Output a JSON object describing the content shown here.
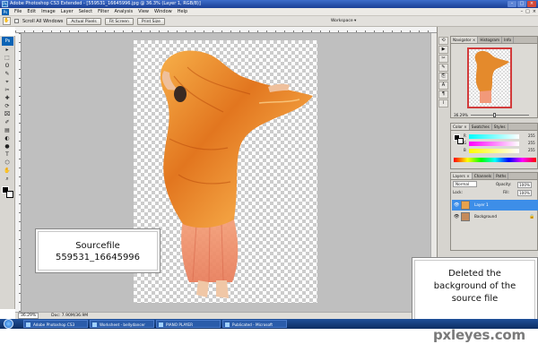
{
  "window": {
    "title": "Adobe Photoshop CS3 Extended - [559531_16645996.jpg @ 36.3% (Layer 1, RGB/8)]",
    "min": "–",
    "max": "□",
    "close": "×",
    "app_icon": "Ps"
  },
  "menu": {
    "items": [
      "File",
      "Edit",
      "Image",
      "Layer",
      "Select",
      "Filter",
      "Analysis",
      "View",
      "Window",
      "Help"
    ],
    "doc_controls": [
      "–",
      "□",
      "×"
    ]
  },
  "options": {
    "tool_icon": "hand-icon",
    "scroll_all_label": "Scroll All Windows",
    "buttons": [
      "Actual Pixels",
      "Fit Screen",
      "Print Size"
    ],
    "workspace_label": "Workspace ▾"
  },
  "toolbox": {
    "logo": "Ps",
    "tools": [
      "▸",
      "⬚",
      "ʘ",
      "✎",
      "⌖",
      "✂",
      "✚",
      "⟳",
      "⌧",
      "✐",
      "▤",
      "◐",
      "●",
      "T",
      "⬡",
      "✋",
      "⌕"
    ]
  },
  "status": {
    "zoom": "36.29%",
    "doc_info": "Doc: 7.90M/36.9M"
  },
  "navigator": {
    "tabs": [
      "Navigator ×",
      "Histogram",
      "Info"
    ],
    "zoom": "36.29%"
  },
  "color_panel": {
    "tabs": [
      "Color ×",
      "Swatches",
      "Styles"
    ],
    "channels": [
      {
        "label": "R",
        "value": "255",
        "color": "#e0407a"
      },
      {
        "label": "G",
        "value": "255",
        "color": "#40d040"
      },
      {
        "label": "B",
        "value": "255",
        "color": "#4a6ae0"
      }
    ]
  },
  "layers_panel": {
    "tabs": [
      "Layers ×",
      "Channels",
      "Paths"
    ],
    "blend_mode": "Normal",
    "opacity_label": "Opacity:",
    "opacity_value": "100%",
    "lock_label": "Lock:",
    "fill_label": "Fill:",
    "fill_value": "100%",
    "layers": [
      {
        "name": "Layer 1",
        "selected": true
      },
      {
        "name": "Background",
        "selected": false
      }
    ]
  },
  "notes": {
    "source": {
      "line1": "Sourcefile",
      "line2": "559531_16645996"
    },
    "deleted": {
      "line1": "Deleted the",
      "line2": "background of the",
      "line3": "source file"
    }
  },
  "taskbar": {
    "items": [
      "Adobe Photoshop CS3",
      "Worksheet - bellydancer",
      "PIANO PLAYER",
      "Publicated - Microsoft"
    ]
  },
  "watermark": "pxleyes.com"
}
